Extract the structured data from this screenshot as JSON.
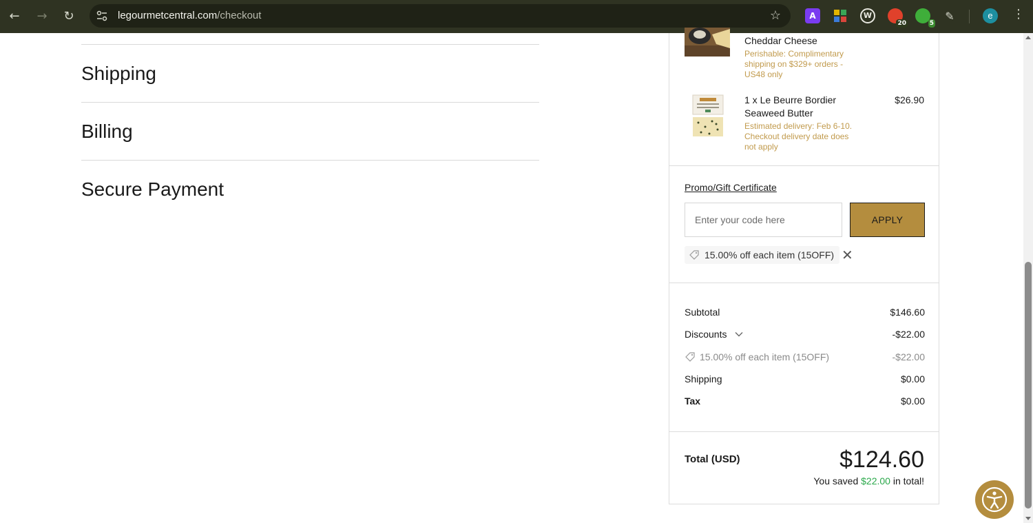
{
  "browser": {
    "url_host": "legourmetcentral.com",
    "url_path": "/checkout",
    "extensions": [
      {
        "name": "ext-a",
        "glyph": "A",
        "color": "#7a3cf0"
      },
      {
        "name": "ext-grid",
        "glyph": "",
        "color": "#e3b400"
      },
      {
        "name": "ext-w",
        "glyph": "W",
        "color": "#222222"
      },
      {
        "name": "ext-red",
        "glyph": "",
        "color": "#e0412b",
        "badge": "20"
      },
      {
        "name": "ext-green",
        "glyph": "",
        "color": "#3fae3a",
        "badge": "5"
      }
    ],
    "profile_initial": "e"
  },
  "steps": [
    "Shipping",
    "Billing",
    "Secure Payment"
  ],
  "items": [
    {
      "name": "Cheddar Cheese",
      "note": "Perishable: Complimentary shipping on $329+ orders - US48 only",
      "price": ""
    },
    {
      "name": "1 x Le Beurre Bordier Seaweed Butter",
      "note": "Estimated delivery: Feb 6-10. Checkout delivery date does not apply",
      "price": "$26.90"
    }
  ],
  "promo": {
    "label": "Promo/Gift Certificate",
    "placeholder": "Enter your code here",
    "apply_label": "APPLY",
    "applied": "15.00% off each item (15OFF)"
  },
  "totals": {
    "subtotal_label": "Subtotal",
    "subtotal": "$146.60",
    "discounts_label": "Discounts",
    "discounts": "-$22.00",
    "discount_detail_label": "15.00% off each item (15OFF)",
    "discount_detail": "-$22.00",
    "shipping_label": "Shipping",
    "shipping": "$0.00",
    "tax_label": "Tax",
    "tax": "$0.00",
    "total_label": "Total (USD)",
    "total": "$124.60",
    "saved_prefix": "You saved",
    "saved_amount": "$22.00",
    "saved_suffix": "in total!"
  },
  "colors": {
    "chrome": "#2f3322",
    "accent_gold": "#b48d3e",
    "note_gold": "#c19a4c",
    "saved_green": "#2aa84a"
  }
}
